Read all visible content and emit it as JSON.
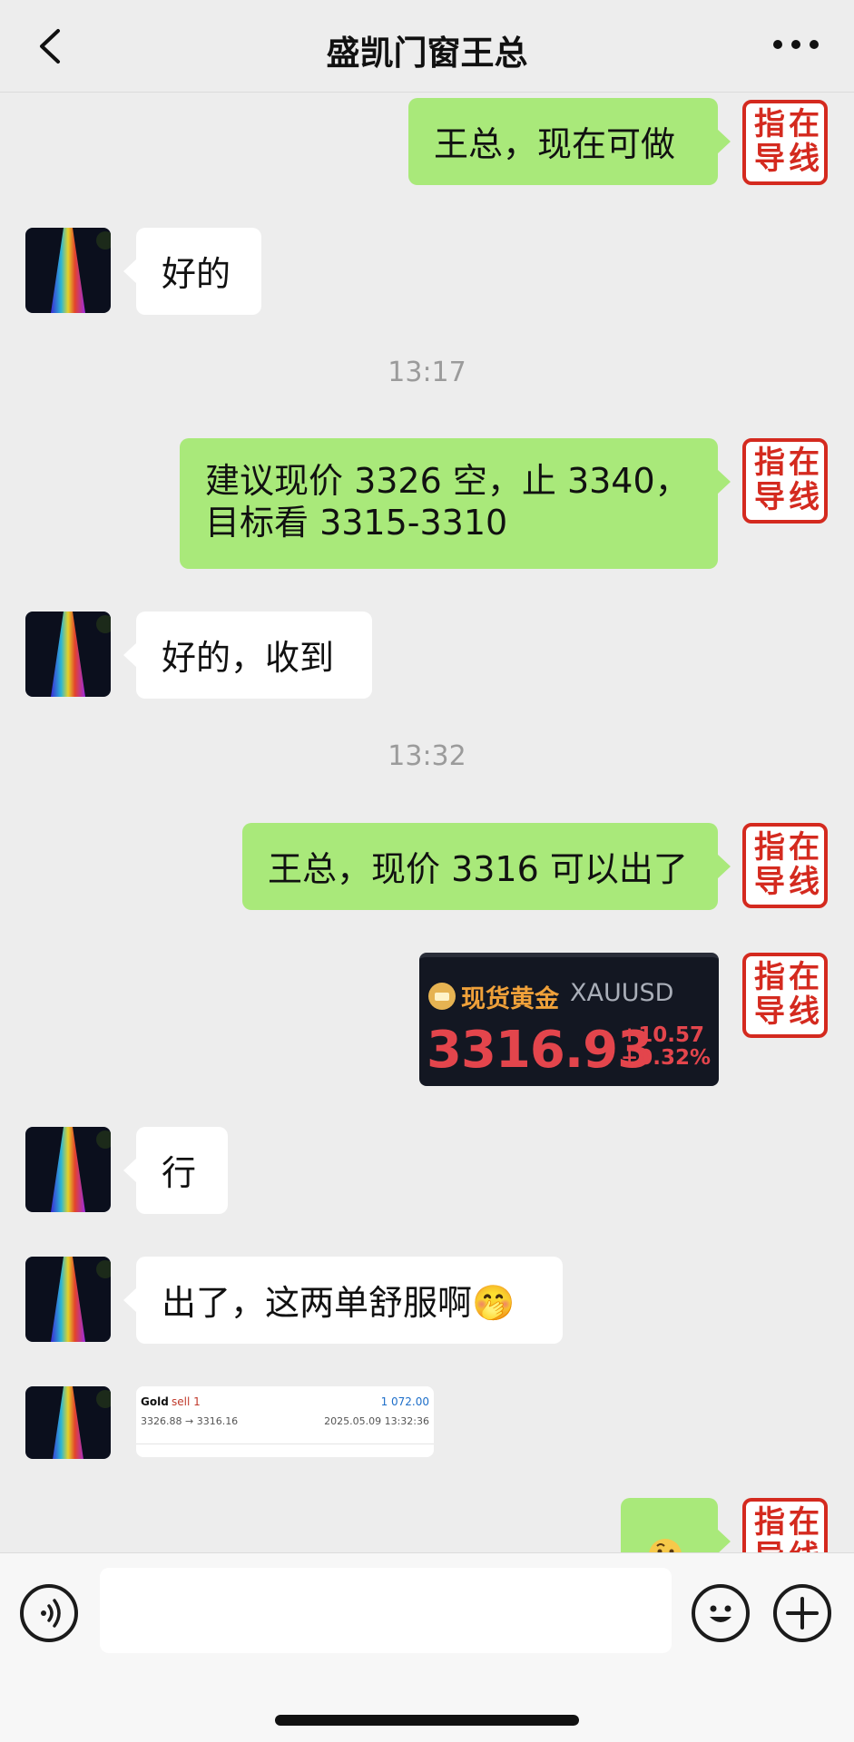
{
  "header": {
    "title": "盛凯门窗王总",
    "back_icon": "chevron-left-icon",
    "more_icon": "more-dots-icon"
  },
  "seal": {
    "chars": [
      "指",
      "在",
      "导",
      "线"
    ],
    "color": "#d42a1f"
  },
  "messages": [
    {
      "type": "text",
      "side": "out",
      "text": "王总，现在可做"
    },
    {
      "type": "text",
      "side": "in",
      "text": "好的"
    },
    {
      "type": "time",
      "text": "13:17"
    },
    {
      "type": "text",
      "side": "out",
      "lines": [
        "建议现价 3326 空，止 3340，",
        "目标看 3315-3310"
      ]
    },
    {
      "type": "text",
      "side": "in",
      "text": "好的，收到"
    },
    {
      "type": "time",
      "text": "13:32"
    },
    {
      "type": "text",
      "side": "out",
      "text": "王总，现价 3316 可以出了"
    },
    {
      "type": "image",
      "side": "out",
      "quote": {
        "name": "现货黄金",
        "symbol": "XAUUSD",
        "price": "3316.93",
        "change": "+10.57",
        "change_pct": "+0.32%"
      }
    },
    {
      "type": "text",
      "side": "in",
      "text": "行"
    },
    {
      "type": "text",
      "side": "in",
      "text": "出了，这两单舒服啊🤭"
    },
    {
      "type": "image",
      "side": "in",
      "trade": {
        "symbol": "Gold",
        "action": "sell 1",
        "profit": "1 072.00",
        "prices": "3326.88 → 3316.16",
        "time": "2025.05.09 13:32:36"
      }
    },
    {
      "type": "sticker",
      "side": "out",
      "icon": "thinking-face-icon"
    }
  ],
  "input": {
    "placeholder": ""
  },
  "colors": {
    "bubble_out": "#a9e97a",
    "bubble_in": "#ffffff",
    "background": "#ededed",
    "quote_red": "#e3454c"
  }
}
